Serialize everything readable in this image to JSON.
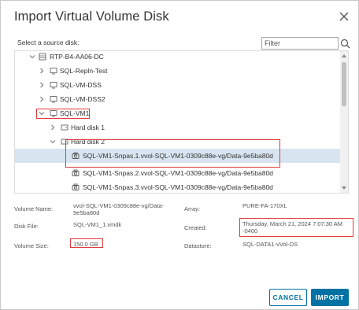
{
  "dialog": {
    "title": "Import Virtual Volume Disk",
    "source_label": "Select a source disk:",
    "filter_placeholder": "Filter"
  },
  "tree": {
    "partial_top": "",
    "datacenter": "RTP-B4-AA06-DC",
    "folders": [
      "SQL-Repln-Test",
      "SQL-VM-DSS",
      "SQL-VM-DSS2"
    ],
    "vm": "SQL-VM1",
    "disks": [
      "Hard disk 1",
      "Hard disk 2"
    ],
    "snapshots": [
      "SQL-VM1-Snpas.1.vvol-SQL-VM1-0309c88e-vg/Data-9e5ba80d",
      "SQL-VM1-Snpas.2.vvol-SQL-VM1-0309c88e-vg/Data-9e5ba80d",
      "SQL-VM1-Snpas.3.vvol-SQL-VM1-0309c88e-vg/Data-9e5ba80d"
    ]
  },
  "details": {
    "volume_name_label": "Volume Name:",
    "volume_name_line1": "vvol-SQL-VM1-0309c88e-vg/Data-",
    "volume_name_line2": "9e5ba80d",
    "array_label": "Array:",
    "array_value": "PURE-FA-170XL",
    "disk_file_label": "Disk File:",
    "disk_file_value": "SQL-VM1_1.vmdk",
    "created_label": "Created:",
    "created_line1": "Thursday, March 21, 2024 7:07:30 AM",
    "created_line2": "-0400",
    "volume_size_label": "Volume Size:",
    "volume_size_value": "150.0 GB",
    "datastore_label": "Datastore:",
    "datastore_value": "SQL-DATA1-vVol-DS"
  },
  "buttons": {
    "cancel": "CANCEL",
    "import": "IMPORT"
  },
  "colors": {
    "accent": "#0072a3",
    "highlight": "#e03a3a",
    "selected_row": "#d8e4f0"
  }
}
